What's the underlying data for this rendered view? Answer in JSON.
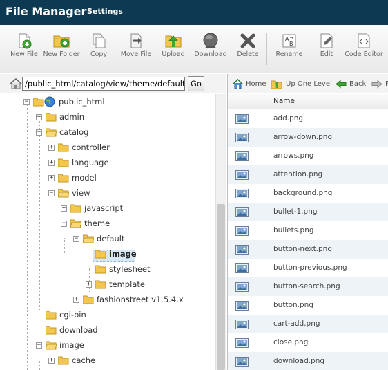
{
  "header": {
    "title": "File Manager",
    "settings_label": "Settings"
  },
  "toolbar": {
    "buttons": [
      {
        "name": "new-file",
        "label": "New File",
        "icon": "new-file-icon"
      },
      {
        "name": "new-folder",
        "label": "New Folder",
        "icon": "new-folder-icon"
      },
      {
        "name": "copy",
        "label": "Copy",
        "icon": "copy-icon"
      },
      {
        "name": "move-file",
        "label": "Move File",
        "icon": "move-icon"
      },
      {
        "name": "upload",
        "label": "Upload",
        "icon": "upload-icon"
      },
      {
        "name": "download",
        "label": "Download",
        "icon": "download-icon"
      },
      {
        "name": "delete",
        "label": "Delete",
        "icon": "delete-icon"
      },
      {
        "name": "rename",
        "label": "Rename",
        "icon": "rename-icon"
      },
      {
        "name": "edit",
        "label": "Edit",
        "icon": "edit-icon"
      },
      {
        "name": "code-editor",
        "label": "Code Editor",
        "icon": "code-editor-icon"
      }
    ]
  },
  "path_bar": {
    "value": "/public_html/catalog/view/theme/default/",
    "go_label": "Go"
  },
  "tree": [
    {
      "label": "public_html",
      "depth": 0,
      "expanded": true,
      "type": "globe-folder"
    },
    {
      "label": "admin",
      "depth": 1,
      "expanded": false,
      "toggle": true
    },
    {
      "label": "catalog",
      "depth": 1,
      "expanded": true,
      "toggle": true
    },
    {
      "label": "controller",
      "depth": 2,
      "expanded": false,
      "toggle": true
    },
    {
      "label": "language",
      "depth": 2,
      "expanded": false,
      "toggle": true
    },
    {
      "label": "model",
      "depth": 2,
      "expanded": false,
      "toggle": true
    },
    {
      "label": "view",
      "depth": 2,
      "expanded": true,
      "toggle": true
    },
    {
      "label": "javascript",
      "depth": 3,
      "expanded": false,
      "toggle": true
    },
    {
      "label": "theme",
      "depth": 3,
      "expanded": true,
      "toggle": true
    },
    {
      "label": "default",
      "depth": 4,
      "expanded": true,
      "toggle": true
    },
    {
      "label": "image",
      "depth": 5,
      "expanded": false,
      "toggle": false,
      "selected": true
    },
    {
      "label": "stylesheet",
      "depth": 5,
      "expanded": false,
      "toggle": false
    },
    {
      "label": "template",
      "depth": 5,
      "expanded": false,
      "toggle": true
    },
    {
      "label": "fashionstreet v1.5.4.x",
      "depth": 4,
      "expanded": false,
      "toggle": true
    },
    {
      "label": "cgi-bin",
      "depth": 1,
      "expanded": false,
      "toggle": false
    },
    {
      "label": "download",
      "depth": 1,
      "expanded": false,
      "toggle": false
    },
    {
      "label": "image",
      "depth": 1,
      "expanded": true,
      "toggle": true
    },
    {
      "label": "cache",
      "depth": 2,
      "expanded": false,
      "toggle": true
    }
  ],
  "nav": {
    "home": "Home",
    "up": "Up One Level",
    "back": "Back",
    "forward": "F"
  },
  "files": {
    "column_name": "Name",
    "items": [
      "add.png",
      "arrow-down.png",
      "arrows.png",
      "attention.png",
      "background.png",
      "bullet-1.png",
      "bullets.png",
      "button-next.png",
      "button-previous.png",
      "button-search.png",
      "button.png",
      "cart-add.png",
      "close.png",
      "download.png"
    ]
  },
  "colors": {
    "header_bg": "#0d3a52",
    "selection": "#d7e8f4",
    "row_alt": "#eef3f8",
    "folder": "#f3c74e"
  }
}
